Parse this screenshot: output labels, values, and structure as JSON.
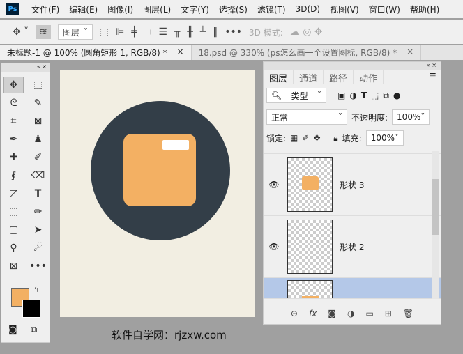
{
  "app": {
    "logo": "Ps"
  },
  "menu": [
    "文件(F)",
    "编辑(E)",
    "图像(I)",
    "图层(L)",
    "文字(Y)",
    "选择(S)",
    "滤镜(T)",
    "3D(D)",
    "视图(V)",
    "窗口(W)",
    "帮助(H)"
  ],
  "options": {
    "auto_select": "图层",
    "mode_label": "3D 模式:"
  },
  "tabs": [
    {
      "label": "未标题-1 @ 100% (圆角矩形 1, RGB/8) *",
      "close": "×"
    },
    {
      "label": "18.psd @ 330% (ps怎么画一个设置图标, RGB/8) *",
      "close": "×"
    }
  ],
  "colors": {
    "foreground": "#f3b063",
    "background": "#000000",
    "canvas": "#f2eee2",
    "circle": "#333e48"
  },
  "layers_panel": {
    "tabs": [
      "图层",
      "通道",
      "路径",
      "动作"
    ],
    "filter": "类型",
    "blend_mode": "正常",
    "opacity_label": "不透明度:",
    "opacity": "100%",
    "lock_label": "锁定:",
    "fill_label": "填充:",
    "fill": "100%",
    "layers": [
      {
        "name": "形状 3",
        "visible": true
      },
      {
        "name": "形状 2",
        "visible": true
      },
      {
        "name": "",
        "visible": false,
        "selected": true
      }
    ]
  },
  "watermark": "软件自学网：rjzxw.com"
}
